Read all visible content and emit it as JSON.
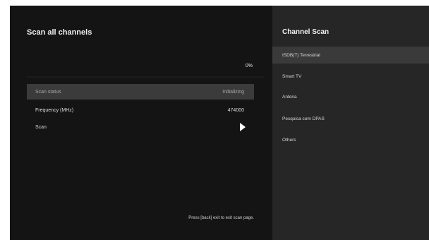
{
  "scan": {
    "title": "Scan all channels",
    "progress_text": "0%",
    "progress": 0,
    "rows": [
      {
        "label": "Scan status",
        "value": "Initializing"
      },
      {
        "label": "Frequency (MHz)",
        "value": "474000"
      },
      {
        "label": "Scan",
        "value": ""
      }
    ],
    "hint": "Press [back] exit to exit scan page."
  },
  "panel": {
    "title": "Channel Scan",
    "items": [
      {
        "label": "ISDB(T) Terrestrial"
      },
      {
        "label": "Smart TV"
      },
      {
        "label": "Antena"
      },
      {
        "label": "Pesquisa com DPAS"
      },
      {
        "label": "Others"
      }
    ]
  }
}
